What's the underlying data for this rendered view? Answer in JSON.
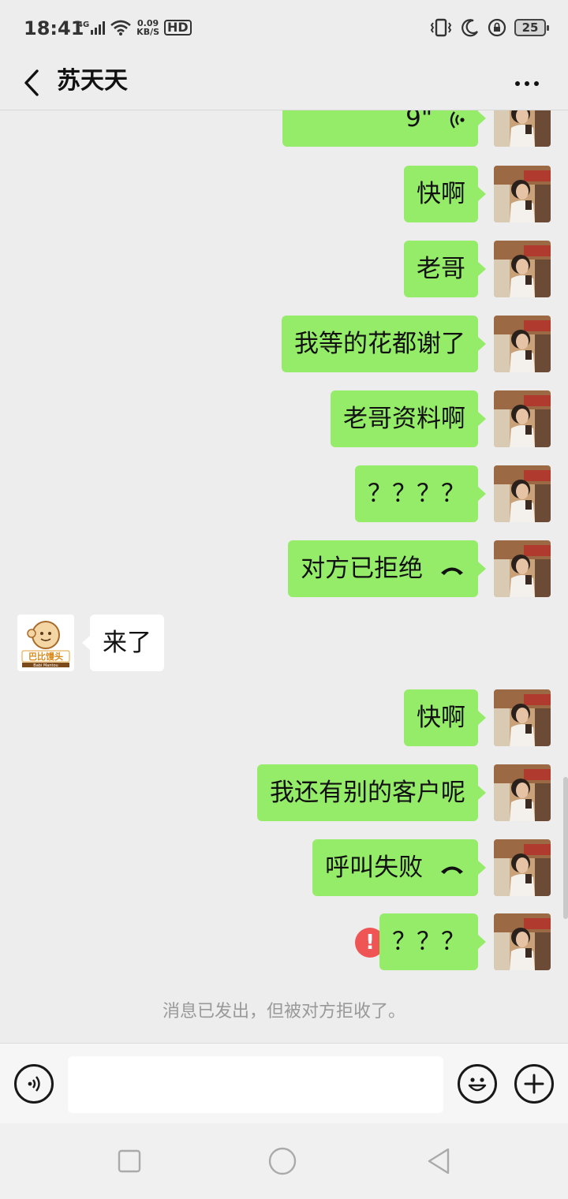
{
  "status_bar": {
    "time": "18:41",
    "network": "4G",
    "speed_value": "0.09",
    "speed_unit": "KB/S",
    "hd": "HD",
    "battery": "25"
  },
  "header": {
    "title": "苏天天"
  },
  "messages": [
    {
      "from": "me",
      "text": "9\"",
      "type": "voice"
    },
    {
      "from": "me",
      "text": "快啊"
    },
    {
      "from": "me",
      "text": "老哥"
    },
    {
      "from": "me",
      "text": "我等的花都谢了"
    },
    {
      "from": "me",
      "text": "老哥资料啊"
    },
    {
      "from": "me",
      "text": "？？？？"
    },
    {
      "from": "me",
      "text": "对方已拒绝",
      "type": "call"
    },
    {
      "from": "other",
      "text": "来了"
    },
    {
      "from": "me",
      "text": "快啊"
    },
    {
      "from": "me",
      "text": "我还有别的客户呢"
    },
    {
      "from": "me",
      "text": "呼叫失败",
      "type": "call"
    },
    {
      "from": "me",
      "text": "？？？",
      "error": "!"
    }
  ],
  "notice": "消息已发出，但被对方拒收了。",
  "input": {
    "value": ""
  },
  "other_avatar": {
    "logo_text": "巴比馒头",
    "logo_subtext": "Babi Mantou"
  },
  "colors": {
    "my_bubble": "#95ec69",
    "other_bubble": "#ffffff",
    "background": "#ededed",
    "error": "#f05555"
  }
}
